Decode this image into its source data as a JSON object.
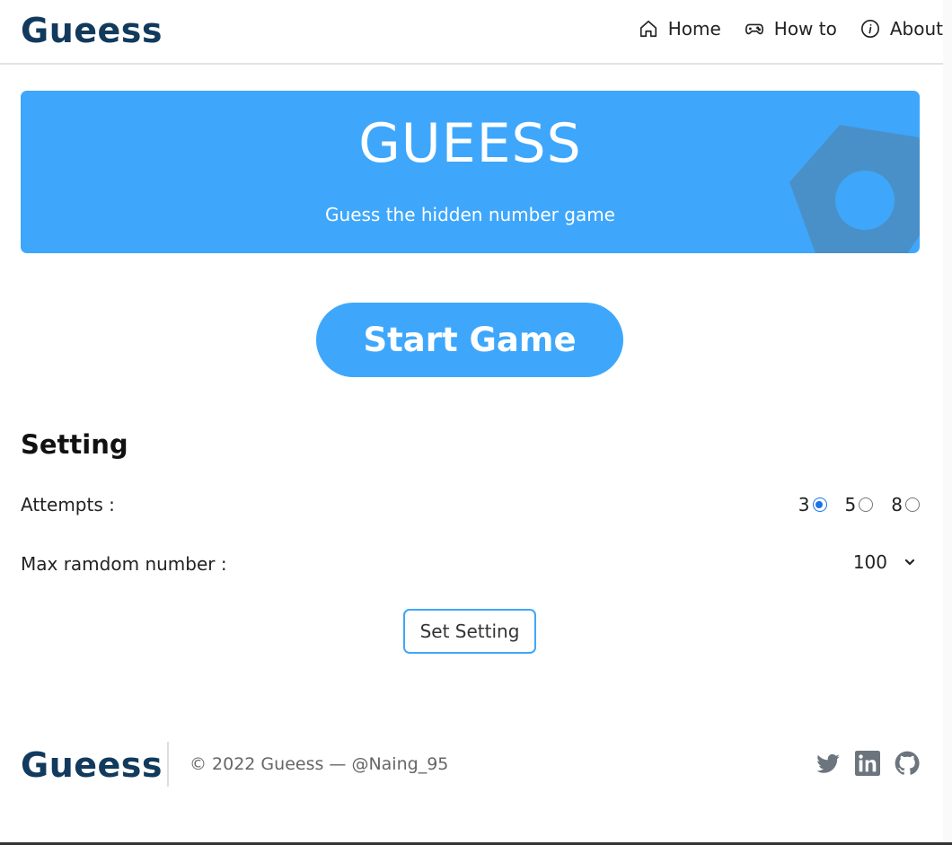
{
  "header": {
    "brand": "Gueess",
    "nav": [
      {
        "label": "Home",
        "icon": "home-icon"
      },
      {
        "label": "How to",
        "icon": "gamepad-icon"
      },
      {
        "label": "About",
        "icon": "info-icon"
      }
    ]
  },
  "hero": {
    "title": "GUEESS",
    "subtitle": "Guess the hidden number game"
  },
  "start_button": "Start Game",
  "setting": {
    "title": "Setting",
    "attempts_label": "Attempts :",
    "attempt_options": [
      "3",
      "5",
      "8"
    ],
    "selected_attempt": "3",
    "max_label": "Max ramdom number :",
    "max_value": "100",
    "set_button": "Set Setting"
  },
  "footer": {
    "brand": "Gueess",
    "copyright": "© 2022 Gueess — @Naing_95",
    "socials": [
      "twitter-icon",
      "linkedin-icon",
      "github-icon"
    ]
  },
  "colors": {
    "accent": "#3ea7fb",
    "brand": "#123a5c",
    "hero_deco": "#4a90c8"
  }
}
